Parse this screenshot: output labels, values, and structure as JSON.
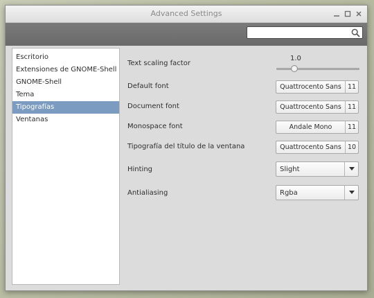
{
  "window": {
    "title": "Advanced Settings"
  },
  "search": {
    "placeholder": ""
  },
  "sidebar": {
    "items": [
      {
        "label": "Escritorio"
      },
      {
        "label": "Extensiones de GNOME-Shell"
      },
      {
        "label": "GNOME-Shell"
      },
      {
        "label": "Tema"
      },
      {
        "label": "Tipografías",
        "selected": true
      },
      {
        "label": "Ventanas"
      }
    ]
  },
  "settings": {
    "text_scaling": {
      "label": "Text scaling factor",
      "value_text": "1.0",
      "value": 1.0
    },
    "default_font": {
      "label": "Default font",
      "font": "Quattrocento Sans",
      "size": "11"
    },
    "document_font": {
      "label": "Document font",
      "font": "Quattrocento Sans",
      "size": "11"
    },
    "monospace_font": {
      "label": "Monospace font",
      "font": "Andale Mono",
      "size": "11"
    },
    "titlebar_font": {
      "label": "Tipografía del título de la ventana",
      "font": "Quattrocento Sans",
      "size": "10"
    },
    "hinting": {
      "label": "Hinting",
      "value": "Slight"
    },
    "antialiasing": {
      "label": "Antialiasing",
      "value": "Rgba"
    }
  },
  "colors": {
    "selection": "#7b9cc0",
    "toolbar": "#707070",
    "window_bg": "#dcdcdc"
  },
  "icons": [
    "minimize-icon",
    "maximize-icon",
    "close-icon",
    "search-icon",
    "chevron-down-icon"
  ]
}
